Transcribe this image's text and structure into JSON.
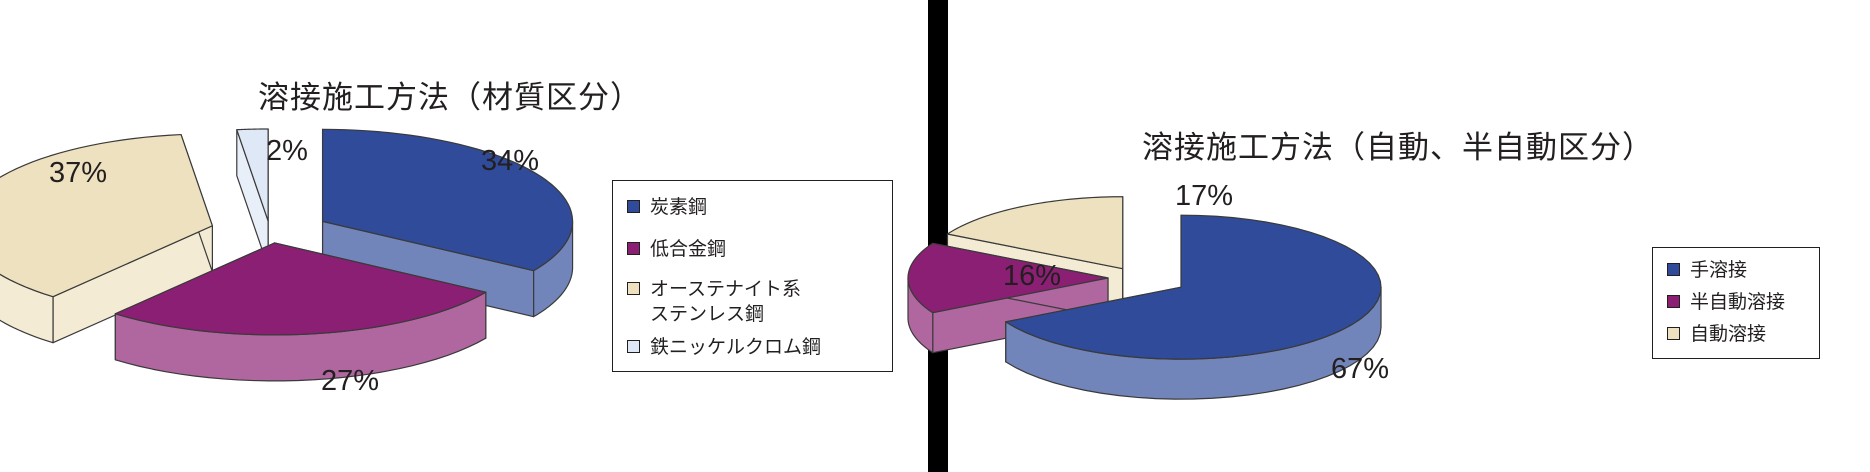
{
  "charts": {
    "left": {
      "title": "溶接施工方法（材質区分）",
      "legend": [
        {
          "label": "炭素鋼",
          "color": "#2f4b99"
        },
        {
          "label": "低合金鋼",
          "color": "#8b1f74"
        },
        {
          "label": "オーステナイト系\nステンレス鋼",
          "color": "#ede1c0"
        },
        {
          "label": "鉄ニッケルクロム鋼",
          "color": "#dfe8f6"
        }
      ]
    },
    "right": {
      "title": "溶接施工方法（自動、半自動区分）",
      "legend": [
        {
          "label": "手溶接",
          "color": "#2f4b99"
        },
        {
          "label": "半自動溶接",
          "color": "#8b1f74"
        },
        {
          "label": "自動溶接",
          "color": "#ede1c0"
        }
      ]
    }
  },
  "chart_data": [
    {
      "type": "pie",
      "title": "溶接施工方法（材質区分）",
      "categories": [
        "炭素鋼",
        "低合金鋼",
        "オーステナイト系ステンレス鋼",
        "鉄ニッケルクロム鋼"
      ],
      "values": [
        34,
        27,
        37,
        2
      ],
      "value_labels": [
        "34%",
        "27%",
        "37%",
        "2%"
      ],
      "exploded": true,
      "three_d": true,
      "legend_position": "right"
    },
    {
      "type": "pie",
      "title": "溶接施工方法（自動、半自動区分）",
      "categories": [
        "手溶接",
        "半自動溶接",
        "自動溶接"
      ],
      "values": [
        67,
        16,
        17
      ],
      "value_labels": [
        "67%",
        "16%",
        "17%"
      ],
      "exploded": true,
      "three_d": true,
      "legend_position": "right"
    }
  ]
}
